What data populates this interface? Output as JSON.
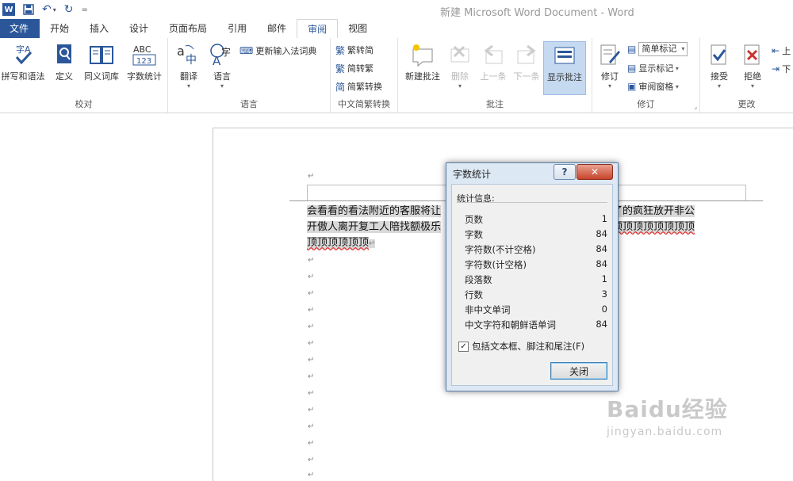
{
  "window": {
    "title": "新建 Microsoft Word Document - Word"
  },
  "qat": {
    "logo": "W",
    "save_icon": "save-icon",
    "undo_icon": "undo-icon",
    "redo_icon": "redo-icon"
  },
  "tabs": [
    "文件",
    "开始",
    "插入",
    "设计",
    "页面布局",
    "引用",
    "邮件",
    "审阅",
    "视图"
  ],
  "active_tab": "审阅",
  "ribbon": {
    "proofing": {
      "label": "校对",
      "buttons": [
        "拼写和语法",
        "定义",
        "同义词库",
        "字数统计"
      ],
      "wordcount_icon_text": "ABC\n123"
    },
    "language": {
      "label": "语言",
      "translate": "翻译",
      "language": "语言",
      "update_ime": "更新输入法词典"
    },
    "chinese_conv": {
      "label": "中文简繁转换",
      "to_simplified": "繁转简",
      "to_traditional": "简转繁",
      "conversion": "简繁转换"
    },
    "comments": {
      "label": "批注",
      "new": "新建批注",
      "delete": "删除",
      "previous": "上一条",
      "next": "下一条",
      "show": "显示批注"
    },
    "tracking": {
      "label": "修订",
      "track": "修订",
      "markup_mode": "简单标记",
      "show_markup": "显示标记",
      "review_pane": "审阅窗格"
    },
    "changes": {
      "label": "更改",
      "accept": "接受",
      "reject": "拒绝",
      "prev_char": "上",
      "next_char": "下"
    }
  },
  "document": {
    "lines": [
      {
        "text": "会看看的看法附近的客服将让",
        "tail": "看过分了的疯狂放开非公"
      },
      {
        "text": "开傲人离开复工人陪找额极乐",
        "tail": "顶顶顶顶顶顶顶顶顶顶顶"
      },
      {
        "text": "顶顶顶顶顶顶",
        "tail": ""
      }
    ],
    "paragraph_mark": "↵"
  },
  "dialog": {
    "title": "字数统计",
    "help": "?",
    "close_x": "✕",
    "section": "统计信息:",
    "stats": [
      {
        "label": "页数",
        "value": "1"
      },
      {
        "label": "字数",
        "value": "84"
      },
      {
        "label": "字符数(不计空格)",
        "value": "84"
      },
      {
        "label": "字符数(计空格)",
        "value": "84"
      },
      {
        "label": "段落数",
        "value": "1"
      },
      {
        "label": "行数",
        "value": "3"
      },
      {
        "label": "非中文单词",
        "value": "0"
      },
      {
        "label": "中文字符和朝鲜语单词",
        "value": "84"
      }
    ],
    "checkbox_label": "包括文本框、脚注和尾注(F)",
    "checkbox_checked": true,
    "close_button": "关闭"
  },
  "watermark": {
    "main": "Baidu经验",
    "sub": "jingyan.baidu.com"
  },
  "colors": {
    "accent": "#2b579a",
    "selected_button": "#c5d9f1",
    "dialog_frame": "#dde8f5"
  }
}
